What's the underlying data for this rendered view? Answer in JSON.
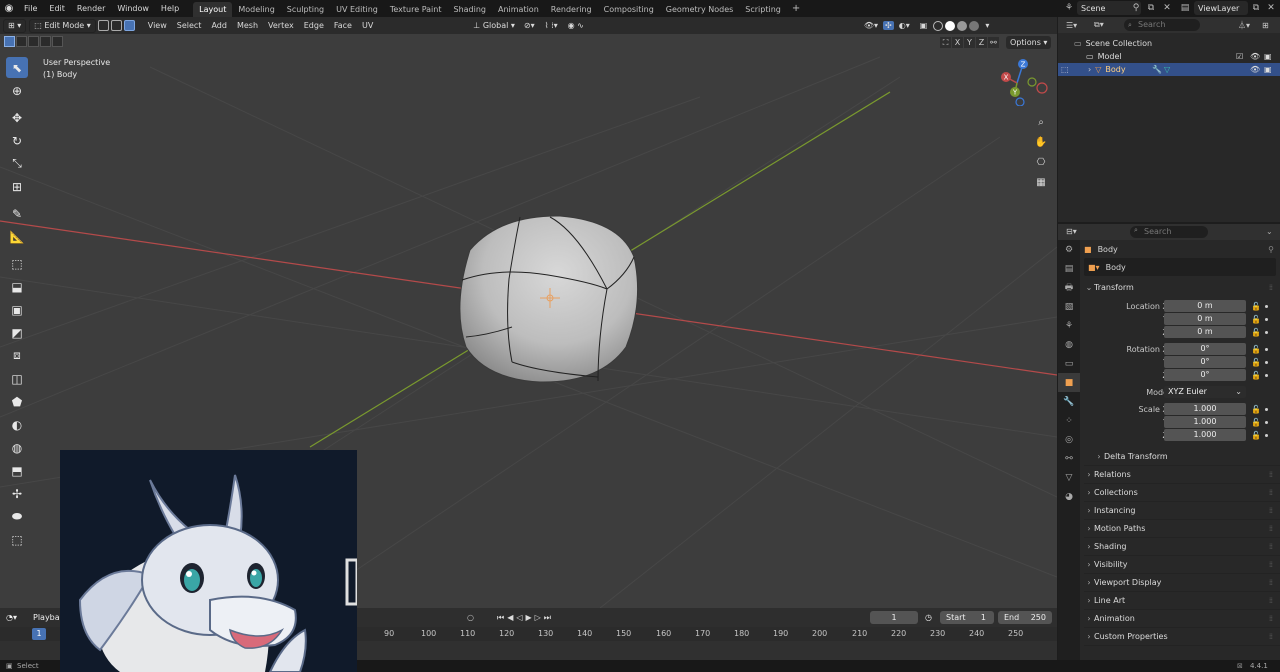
{
  "top_menu": [
    "File",
    "Edit",
    "Render",
    "Window",
    "Help"
  ],
  "workspaces": [
    {
      "label": "Layout",
      "active": true
    },
    {
      "label": "Modeling",
      "active": false
    },
    {
      "label": "Sculpting",
      "active": false
    },
    {
      "label": "UV Editing",
      "active": false
    },
    {
      "label": "Texture Paint",
      "active": false
    },
    {
      "label": "Shading",
      "active": false
    },
    {
      "label": "Animation",
      "active": false
    },
    {
      "label": "Rendering",
      "active": false
    },
    {
      "label": "Compositing",
      "active": false
    },
    {
      "label": "Geometry Nodes",
      "active": false
    },
    {
      "label": "Scripting",
      "active": false
    }
  ],
  "scene": "Scene",
  "view_layer": "ViewLayer",
  "viewport": {
    "mode": "Edit Mode",
    "menus": [
      "View",
      "Select",
      "Add",
      "Mesh",
      "Vertex",
      "Edge",
      "Face",
      "UV"
    ],
    "orientation": "Global",
    "perspective_label": "User Perspective",
    "object_label": "(1) Body",
    "options_label": "Options",
    "axis_buttons": [
      "X",
      "Y",
      "Z"
    ]
  },
  "outliner": {
    "search_placeholder": "Search",
    "rows": [
      {
        "label": "Scene Collection"
      },
      {
        "label": "Model"
      },
      {
        "label": "Body"
      }
    ]
  },
  "properties": {
    "search_placeholder": "Search",
    "context_name": "Body",
    "object_name": "Body",
    "transform_title": "Transform",
    "location_label": "Location X",
    "location": [
      "0 m",
      "0 m",
      "0 m"
    ],
    "rotation_label": "Rotation X",
    "rotation": [
      "0°",
      "0°",
      "0°"
    ],
    "mode_label": "Mode",
    "mode_value": "XYZ Euler",
    "scale_label": "Scale X",
    "scale": [
      "1.000",
      "1.000",
      "1.000"
    ],
    "axis_y": "Y",
    "axis_z": "Z",
    "delta_transform": "Delta Transform",
    "sections": [
      "Relations",
      "Collections",
      "Instancing",
      "Motion Paths",
      "Shading",
      "Visibility",
      "Viewport Display",
      "Line Art",
      "Animation",
      "Custom Properties"
    ]
  },
  "timeline": {
    "playback_label": "Playba",
    "current_frame": "1",
    "start_label": "Start",
    "start_value": "1",
    "end_label": "End",
    "end_value": "250",
    "playhead_frame": "1",
    "ticks": [
      "90",
      "100",
      "110",
      "120",
      "130",
      "140",
      "150",
      "160",
      "170",
      "180",
      "190",
      "200",
      "210",
      "220",
      "230",
      "240",
      "250"
    ]
  },
  "statusbar": {
    "left": "Select",
    "version": "4.4.1"
  },
  "colors": {
    "accent": "#4772b3",
    "x_axis": "#b44a4a",
    "y_axis": "#7a9a2e",
    "z_axis": "#3a78d8"
  }
}
